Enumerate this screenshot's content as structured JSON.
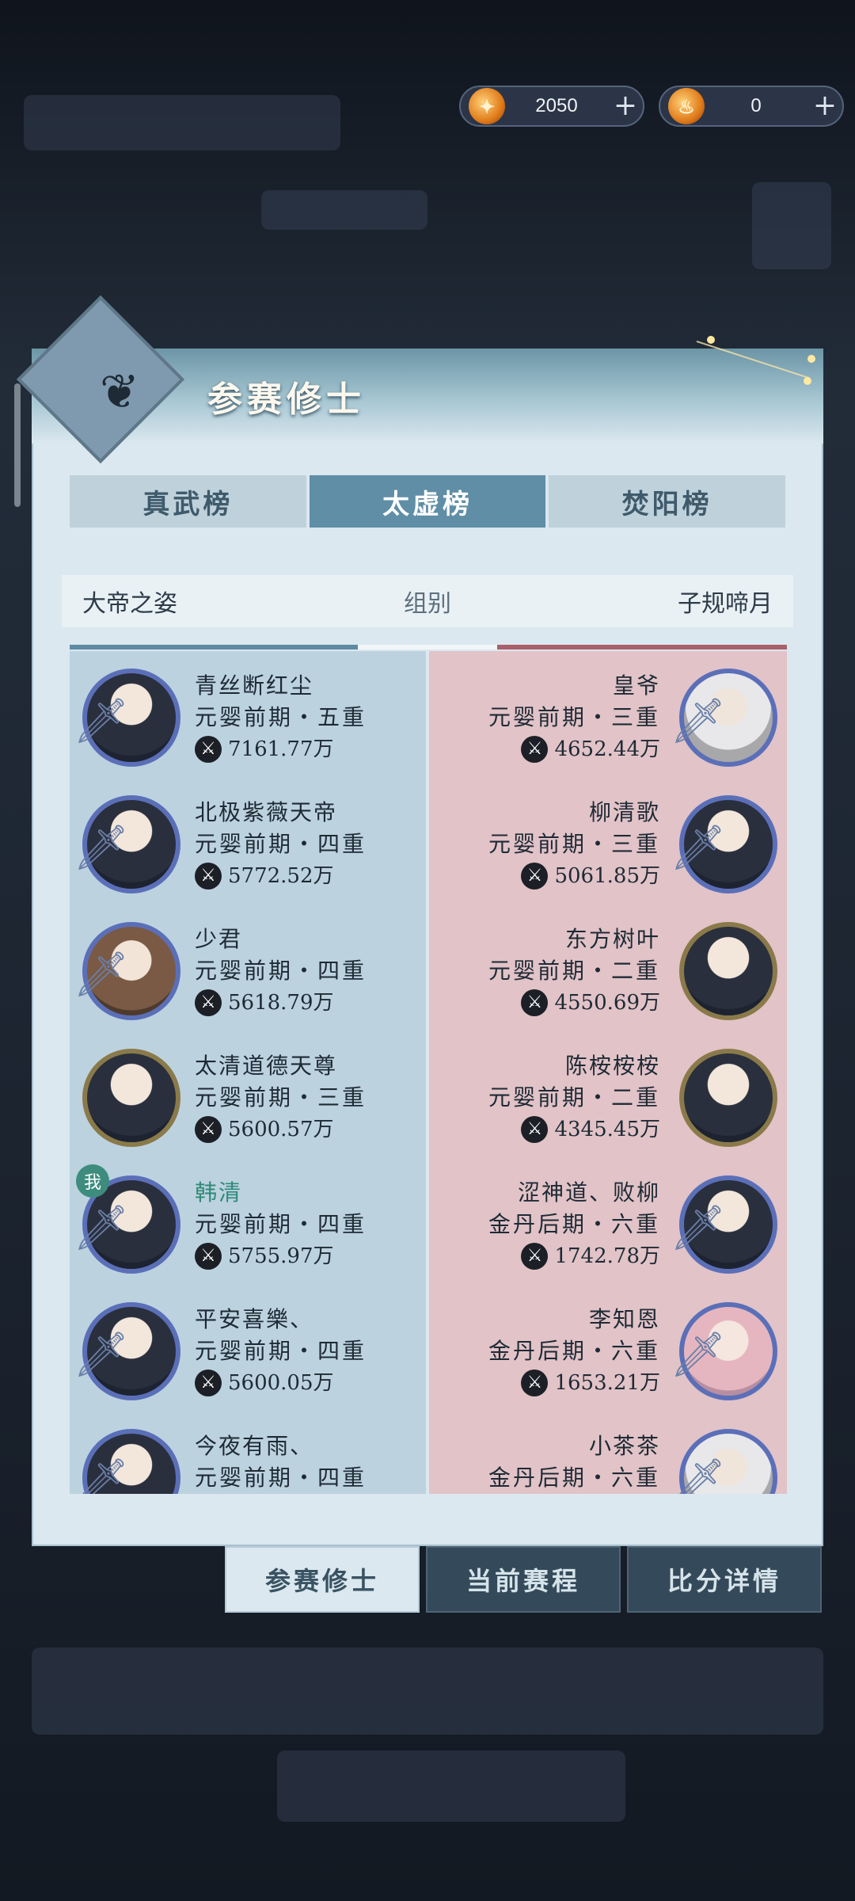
{
  "currency": [
    {
      "icon": "gold-coin-icon",
      "value": "2050",
      "plus": "+"
    },
    {
      "icon": "flame-token-icon",
      "value": "0",
      "plus": "+"
    }
  ],
  "panel": {
    "title": "参赛修士",
    "tabs": [
      {
        "label": "真武榜",
        "active": false
      },
      {
        "label": "太虚榜",
        "active": true
      },
      {
        "label": "焚阳榜",
        "active": false
      }
    ],
    "group": {
      "left": "大帝之姿",
      "middle": "组别",
      "right": "子规啼月"
    }
  },
  "left_team": [
    {
      "name": "青丝断红尘",
      "realm": "元婴前期・五重",
      "power": "7161.77万"
    },
    {
      "name": "北极紫薇天帝",
      "realm": "元婴前期・四重",
      "power": "5772.52万"
    },
    {
      "name": "少君",
      "realm": "元婴前期・四重",
      "power": "5618.79万"
    },
    {
      "name": "太清道德天尊",
      "realm": "元婴前期・三重",
      "power": "5600.57万"
    },
    {
      "name": "韩清",
      "realm": "元婴前期・四重",
      "power": "5755.97万",
      "me_badge": "我"
    },
    {
      "name": "平安喜樂、",
      "realm": "元婴前期・四重",
      "power": "5600.05万"
    },
    {
      "name": "今夜有雨、",
      "realm": "元婴前期・四重",
      "power": ""
    }
  ],
  "right_team": [
    {
      "name": "皇爷",
      "realm": "元婴前期・三重",
      "power": "4652.44万"
    },
    {
      "name": "柳清歌",
      "realm": "元婴前期・三重",
      "power": "5061.85万"
    },
    {
      "name": "东方树叶",
      "realm": "元婴前期・二重",
      "power": "4550.69万"
    },
    {
      "name": "陈桉桉桉",
      "realm": "元婴前期・二重",
      "power": "4345.45万"
    },
    {
      "name": "涩神道、败柳",
      "realm": "金丹后期・六重",
      "power": "1742.78万"
    },
    {
      "name": "李知恩",
      "realm": "金丹后期・六重",
      "power": "1653.21万"
    },
    {
      "name": "小茶茶",
      "realm": "金丹后期・六重",
      "power": ""
    }
  ],
  "bottom_nav": [
    {
      "label": "参赛修士",
      "active": true
    },
    {
      "label": "当前赛程",
      "active": false
    },
    {
      "label": "比分详情",
      "active": false
    }
  ]
}
